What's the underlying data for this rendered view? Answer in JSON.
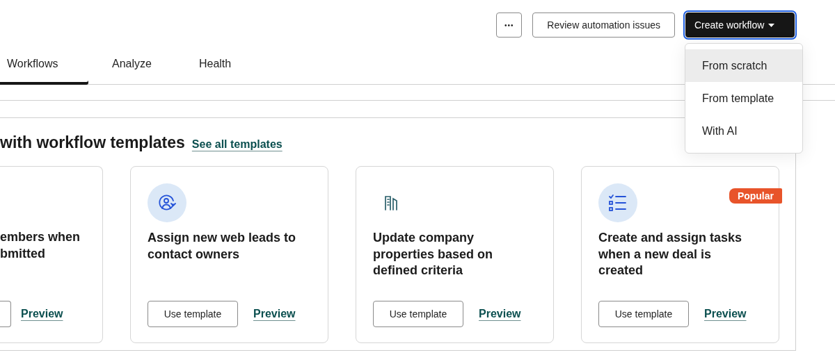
{
  "header_buttons": [
    {
      "kind": "more",
      "label": "•••"
    },
    {
      "kind": "outline",
      "label": "Review automation issues"
    },
    {
      "kind": "primary",
      "label": "Create workflow",
      "focused": true
    }
  ],
  "dropdown": {
    "items": [
      {
        "label": "From scratch",
        "selected": true
      },
      {
        "label": "From template",
        "selected": false
      },
      {
        "label": "With AI",
        "selected": false
      }
    ]
  },
  "tabs": [
    {
      "label": "Workflows",
      "selected": true
    },
    {
      "label": "Analyze",
      "selected": false
    },
    {
      "label": "Health",
      "selected": false
    }
  ],
  "section": {
    "heading": "with workflow templates",
    "link": "See all templates"
  },
  "cards": [
    {
      "kind": "partial",
      "title": "embers when bmitted",
      "preview": "Preview"
    },
    {
      "kind": "person",
      "title": "Assign new web leads to contact owners",
      "button": "Use template",
      "preview": "Preview"
    },
    {
      "kind": "building",
      "title": "Update company properties based on defined criteria",
      "button": "Use template",
      "preview": "Preview"
    },
    {
      "kind": "checklist",
      "badge": "Popular",
      "title": "Create and assign tasks when a new deal is created",
      "button": "Use template",
      "preview": "Preview"
    }
  ]
}
